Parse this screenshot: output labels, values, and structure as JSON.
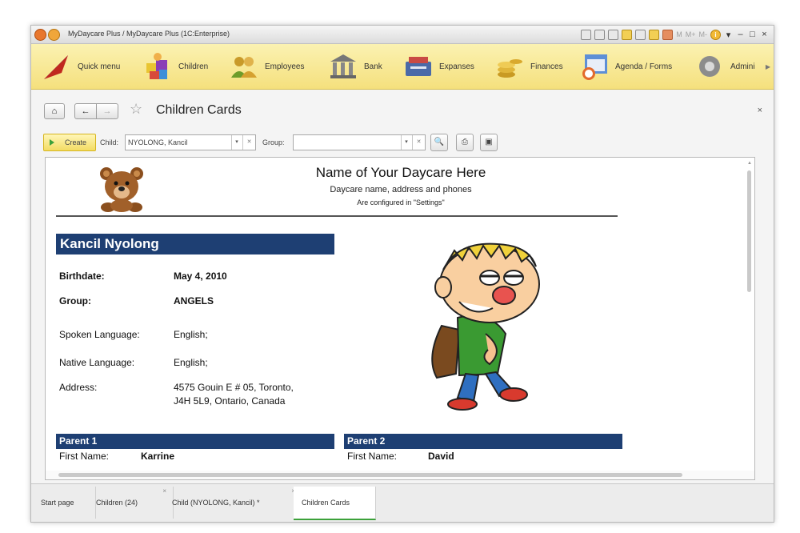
{
  "window": {
    "title": "MyDaycare Plus / MyDaycare Plus (1C:Enterprise)",
    "toolbar_text": [
      "M",
      "M+",
      "M-"
    ]
  },
  "sections": [
    {
      "label": "Quick menu",
      "icon": "quick-menu-icon"
    },
    {
      "label": "Children",
      "icon": "children-icon"
    },
    {
      "label": "Employees",
      "icon": "employees-icon"
    },
    {
      "label": "Bank",
      "icon": "bank-icon"
    },
    {
      "label": "Expanses",
      "icon": "expanses-icon"
    },
    {
      "label": "Finances",
      "icon": "finances-icon"
    },
    {
      "label": "Agenda / Forms",
      "icon": "agenda-icon"
    },
    {
      "label": "Admini",
      "icon": "admin-gear-icon"
    }
  ],
  "form": {
    "title": "Children Cards",
    "create_label": "Create",
    "child_label": "Child:",
    "child_value": "NYOLONG, Kancil",
    "group_label": "Group:",
    "group_value": ""
  },
  "report": {
    "daycare_name": "Name of Your Daycare Here",
    "daycare_sub": "Daycare name, address and phones",
    "daycare_sub2": "Are configured in \"Settings\"",
    "child_name": "Kancil Nyolong",
    "birthdate_label": "Birthdate:",
    "birthdate_value": "May 4, 2010",
    "group_label": "Group:",
    "group_value": "ANGELS",
    "spoken_label": "Spoken Language:",
    "spoken_value": "English;",
    "native_label": "Native Language:",
    "native_value": "English;",
    "address_label": "Address:",
    "address_line1": "4575 Gouin E # 05, Toronto,",
    "address_line2": "J4H 5L9, Ontario, Canada",
    "parent1": {
      "header": "Parent 1",
      "first_name_label": "First Name:",
      "first_name": "Karrine"
    },
    "parent2": {
      "header": "Parent 2",
      "first_name_label": "First Name:",
      "first_name": "David"
    }
  },
  "tabs": [
    {
      "label": "Start page",
      "closable": false
    },
    {
      "label": "Children (24)",
      "closable": true
    },
    {
      "label": "Child (NYOLONG, Kancil) *",
      "closable": true
    },
    {
      "label": "Children Cards",
      "closable": false,
      "active": true
    }
  ],
  "colors": {
    "accent_blue": "#1e3f73",
    "section_bar": "#f5e07d",
    "active_tab": "#3ca13a"
  }
}
